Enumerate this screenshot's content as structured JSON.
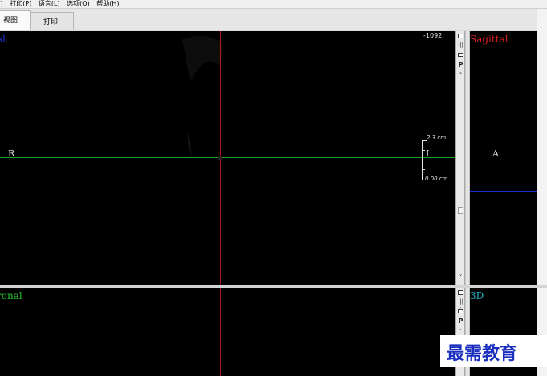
{
  "menu": {
    "items": [
      "F)",
      "打印(P)",
      "语言(L)",
      "选项(O)",
      "帮助(H)"
    ]
  },
  "tabs": {
    "active_label": "视图",
    "inactive_label": "打印"
  },
  "axial": {
    "label": "al",
    "label_color": "#1f2fd6",
    "window_value": "-1092",
    "left_orientation": "R",
    "right_orientation": "L",
    "scale_top": "2.3  cm",
    "scale_bottom": "0.00  cm"
  },
  "sagittal": {
    "label": "Sagittal",
    "label_color": "#d92020",
    "orientation": "A"
  },
  "coronal": {
    "label": "ronal",
    "label_color": "#27c227"
  },
  "threed": {
    "label": "3D",
    "label_color": "#26b3c9"
  },
  "toolbar": {
    "p_label": "P",
    "up_arrow": "˄",
    "down_arrow": "˅",
    "split_icon": "·||·"
  },
  "colors": {
    "crosshair_vertical": "#b01a1a",
    "crosshair_horizontal": "#1fa01f",
    "sagittal_line": "#1a2fd0"
  },
  "watermark": {
    "text": "最需教育"
  }
}
